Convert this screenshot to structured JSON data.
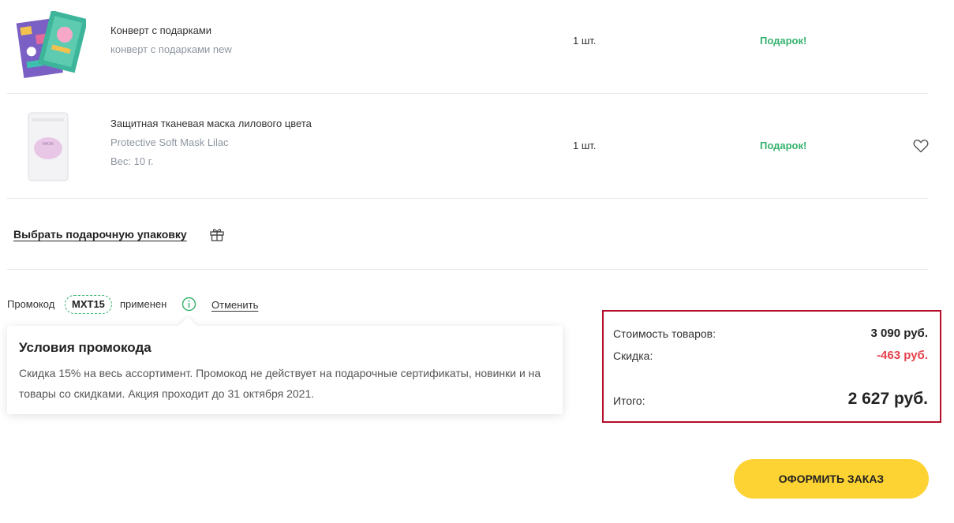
{
  "items": [
    {
      "name": "Конверт с подарками",
      "subtitle": "конверт с подарками new",
      "quantity": "1 шт.",
      "price_label": "Подарок!",
      "image_icon": "gift-envelope-image"
    },
    {
      "name": "Защитная тканевая маска лилового цвета",
      "subtitle": "Protective Soft Mask Lilac",
      "weight": "Вес: 10 г.",
      "quantity": "1 шт.",
      "price_label": "Подарок!",
      "image_icon": "mask-package-image",
      "package_text": "MASK",
      "favorite_icon": "heart-icon"
    }
  ],
  "gift_wrap": {
    "label": "Выбрать подарочную упаковку",
    "icon": "gift-box-icon"
  },
  "promo": {
    "label": "Промокод",
    "code": "MXT15",
    "status": "применен",
    "info_icon": "info-icon",
    "cancel": "Отменить"
  },
  "promo_popover": {
    "title": "Условия промокода",
    "text": "Скидка 15% на весь ассортимент. Промокод не действует на подарочные сертификаты, новинки и на товары со скидками. Акция проходит до 31 октября 2021."
  },
  "summary": {
    "goods_label": "Стоимость товаров:",
    "goods_value": "3 090 руб.",
    "discount_label": "Скидка:",
    "discount_value": "-463 руб.",
    "total_label": "Итого:",
    "total_value": "2 627 руб."
  },
  "order_button": "ОФОРМИТЬ ЗАКАЗ",
  "colors": {
    "gift_green": "#35b26e",
    "discount_red": "#e5414b",
    "button_yellow": "#fdd233",
    "highlight_border": "#b40d2a"
  }
}
